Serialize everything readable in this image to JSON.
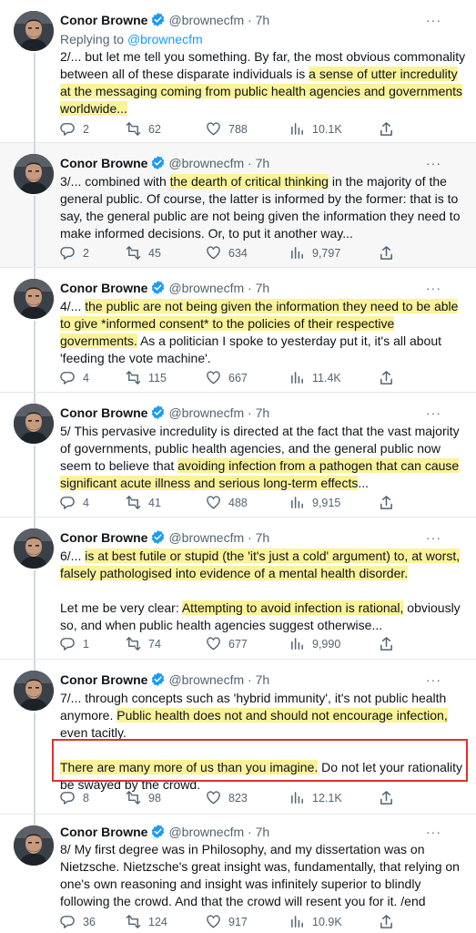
{
  "accent": "#1d9bf0",
  "highlight_color": "#fbf39a",
  "annotation_box_color": "#e0322a",
  "author": {
    "name": "Conor Browne",
    "handle": "@brownecfm",
    "dot": "·",
    "verified_icon": "verified-badge-icon"
  },
  "more_label": "···",
  "tweets": [
    {
      "time": "7h",
      "replying_to_prefix": "Replying to ",
      "replying_to_handle": "@brownecfm",
      "text": [
        [
          [
            "2/... but let me tell you something. By far, the most obvious commonality between all of these disparate individuals is ",
            false
          ],
          [
            "a sense of utter incredulity at the messaging coming from public health agencies and governments worldwide...",
            true
          ]
        ]
      ],
      "counts": {
        "replies": "2",
        "retweets": "62",
        "likes": "788",
        "views": "10.1K"
      }
    },
    {
      "time": "7h",
      "text": [
        [
          [
            "3/... combined with ",
            false
          ],
          [
            "the dearth of critical thinking",
            true
          ],
          [
            " in the majority of the general public. Of course, the latter is informed by the former: that is to say, the general public are not being given the information they need to make informed decisions. Or, to put it another way...",
            false
          ]
        ]
      ],
      "counts": {
        "replies": "2",
        "retweets": "45",
        "likes": "634",
        "views": "9,797"
      }
    },
    {
      "time": "7h",
      "text": [
        [
          [
            "4/... ",
            false
          ],
          [
            "the public are not being given the information they need to be able to give *informed consent* to the policies of their respective governments.",
            true
          ],
          [
            " As a politician I spoke to yesterday put it, it's all about 'feeding the vote machine'.",
            false
          ]
        ]
      ],
      "counts": {
        "replies": "4",
        "retweets": "115",
        "likes": "667",
        "views": "11.4K"
      }
    },
    {
      "time": "7h",
      "text": [
        [
          [
            "5/ This pervasive incredulity is directed at the fact that the vast majority of governments, public health agencies, and the general public now seem to believe that ",
            false
          ],
          [
            "avoiding infection from a pathogen that can cause significant acute illness and serious long-term effects",
            true
          ],
          [
            "...",
            false
          ]
        ]
      ],
      "counts": {
        "replies": "4",
        "retweets": "41",
        "likes": "488",
        "views": "9,915"
      }
    },
    {
      "time": "7h",
      "text": [
        [
          [
            "6/... ",
            false
          ],
          [
            "is at best futile or stupid (the 'it's just a cold' argument) to, at worst, falsely pathologised into evidence of a mental health disorder.",
            true
          ]
        ],
        [
          [
            "Let me be very clear: ",
            false
          ],
          [
            "Attempting to avoid infection is rational,",
            true
          ],
          [
            " obviously so, and when public health agencies suggest otherwise...",
            false
          ]
        ]
      ],
      "counts": {
        "replies": "1",
        "retweets": "74",
        "likes": "677",
        "views": "9,990"
      }
    },
    {
      "time": "7h",
      "text": [
        [
          [
            "7/... through concepts such as 'hybrid immunity', it's not public health anymore. ",
            false
          ],
          [
            "Public health does not and should not encourage infection,",
            true
          ],
          [
            " even tacitly.",
            false
          ]
        ],
        [
          [
            "There are many more of us than you imagine.",
            true
          ],
          [
            " Do not let your rationality be swayed by the crowd.",
            false
          ]
        ]
      ],
      "counts": {
        "replies": "8",
        "retweets": "98",
        "likes": "823",
        "views": "12.1K"
      }
    },
    {
      "time": "7h",
      "text": [
        [
          [
            "8/ My first degree was in Philosophy, and my dissertation was on Nietzsche. Nietzsche's great insight was, fundamentally, that relying on one's own reasoning and insight was infinitely superior to blindly following the crowd. And that the crowd will resent you for it. /end",
            false
          ]
        ]
      ],
      "counts": {
        "replies": "36",
        "retweets": "124",
        "likes": "917",
        "views": "10.9K"
      }
    }
  ]
}
